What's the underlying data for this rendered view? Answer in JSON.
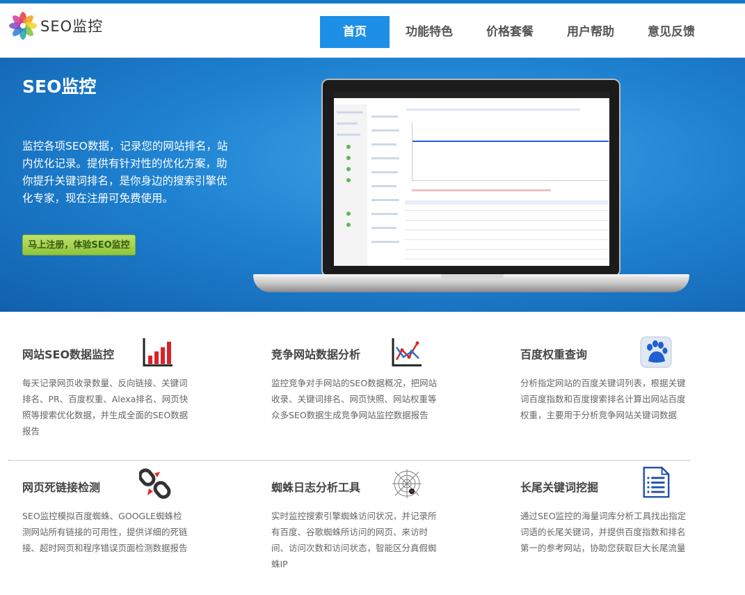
{
  "header": {
    "logo_text": "SEO监控",
    "nav": [
      {
        "label": "首页",
        "active": true
      },
      {
        "label": "功能特色",
        "active": false
      },
      {
        "label": "价格套餐",
        "active": false
      },
      {
        "label": "用户帮助",
        "active": false
      },
      {
        "label": "意见反馈",
        "active": false
      }
    ]
  },
  "banner": {
    "title": "SEO监控",
    "description": "监控各项SEO数据，记录您的网站排名，站内优化记录。提供有针对性的优化方案，助你提升关键词排名，是你身边的搜索引擎优化专家，现在注册可免费使用。",
    "cta_label": "马上注册，体验SEO监控"
  },
  "features": [
    {
      "title": "网站SEO数据监控",
      "icon": "bar-chart-icon",
      "description": "每天记录网页收录数量、反向链接、关键词排名、PR、百度权重、Alexa排名、网页快照等搜索优化数据，并生成全面的SEO数据报告"
    },
    {
      "title": "竞争网站数据分析",
      "icon": "line-chart-icon",
      "description": "监控竞争对手网站的SEO数据概况，把网站收录、关键词排名、网页快照、网站权重等众多SEO数据生成竞争网站监控数据报告"
    },
    {
      "title": "百度权重查询",
      "icon": "baidu-paw-icon",
      "description": "分析指定网站的百度关键词列表，根据关键词百度指数和百度搜索排名计算出网站百度权重，主要用于分析竞争网站关键词数据"
    },
    {
      "title": "网页死链接检测",
      "icon": "broken-link-icon",
      "description": "SEO监控模拟百度蜘蛛、GOOGLE蜘蛛检测网站所有链接的可用性，提供详细的死链接、超时网页和程序错误页面检测数据报告"
    },
    {
      "title": "蜘蛛日志分析工具",
      "icon": "spider-web-icon",
      "description": "实时监控搜索引擎蜘蛛访问状况，并记录所有百度、谷歌蜘蛛所访问的网页、来访时间、访问次数和访问状态，智能区分真假蜘蛛IP"
    },
    {
      "title": "长尾关键词挖掘",
      "icon": "document-list-icon",
      "description": "通过SEO监控的海量词库分析工具找出指定词语的长尾关键词，并提供百度指数和排名第一的参考网站，协助您获取巨大长尾流量"
    }
  ]
}
